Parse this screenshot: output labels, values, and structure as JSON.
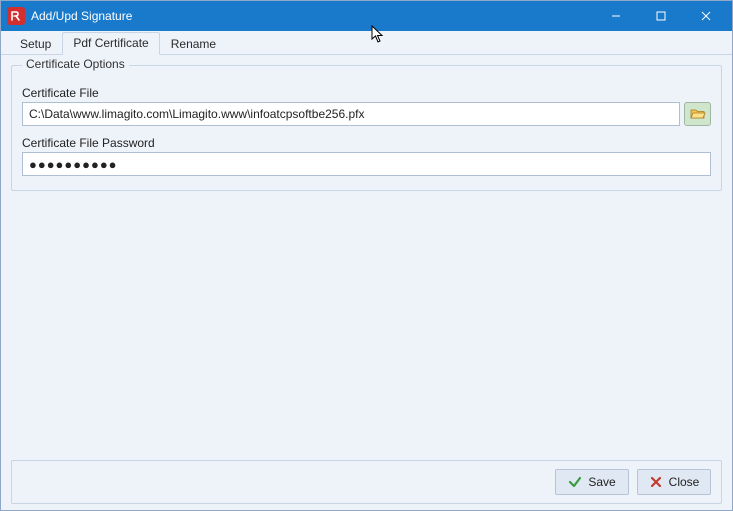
{
  "window": {
    "title": "Add/Upd Signature"
  },
  "tabs": {
    "setup": "Setup",
    "pdf_certificate": "Pdf Certificate",
    "rename": "Rename",
    "active": "pdf_certificate"
  },
  "group": {
    "title": "Certificate Options",
    "cert_file_label": "Certificate File",
    "cert_file_value": "C:\\Data\\www.limagito.com\\Limagito.www\\infoatcpsoftbe256.pfx",
    "cert_pw_label": "Certificate File Password",
    "cert_pw_value": "●●●●●●●●●●"
  },
  "footer": {
    "save_label": "Save",
    "close_label": "Close"
  }
}
